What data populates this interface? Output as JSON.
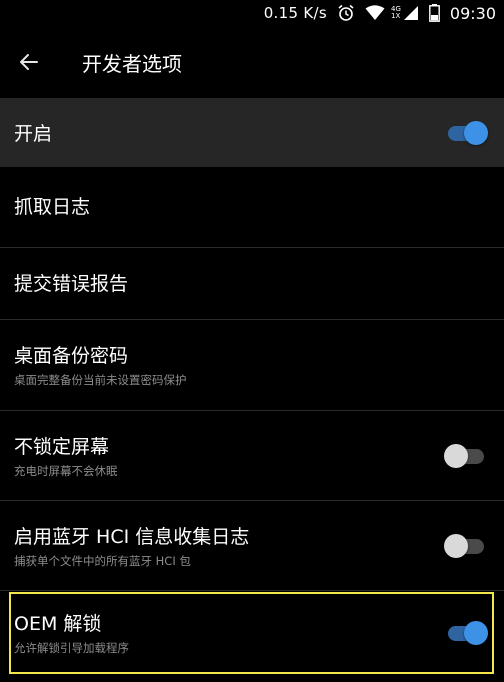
{
  "status_bar": {
    "net_speed": "0.15 K/s",
    "net_small_top": "4G",
    "net_small_bottom": "1X",
    "time": "09:30",
    "icons": [
      "alarm-icon",
      "wifi-icon",
      "signal-icon",
      "battery-icon"
    ]
  },
  "toolbar": {
    "title": "开发者选项",
    "back_icon": "arrow-left-icon"
  },
  "master_switch": {
    "label": "开启",
    "on": true
  },
  "settings": [
    {
      "title": "抓取日志",
      "subtitle": ""
    },
    {
      "title": "提交错误报告",
      "subtitle": ""
    },
    {
      "title": "桌面备份密码",
      "subtitle": "桌面完整备份当前未设置密码保护"
    },
    {
      "title": "不锁定屏幕",
      "subtitle": "充电时屏幕不会休眠",
      "switch": false
    },
    {
      "title": "启用蓝牙 HCI 信息收集日志",
      "subtitle": "捕获单个文件中的所有蓝牙 HCI 包",
      "switch": false
    },
    {
      "title": "OEM 解锁",
      "subtitle": "允许解锁引导加载程序",
      "switch": true
    }
  ],
  "colors": {
    "accent": "#3d92e8",
    "highlight": "#f2e64b",
    "master_bg": "#262626"
  }
}
